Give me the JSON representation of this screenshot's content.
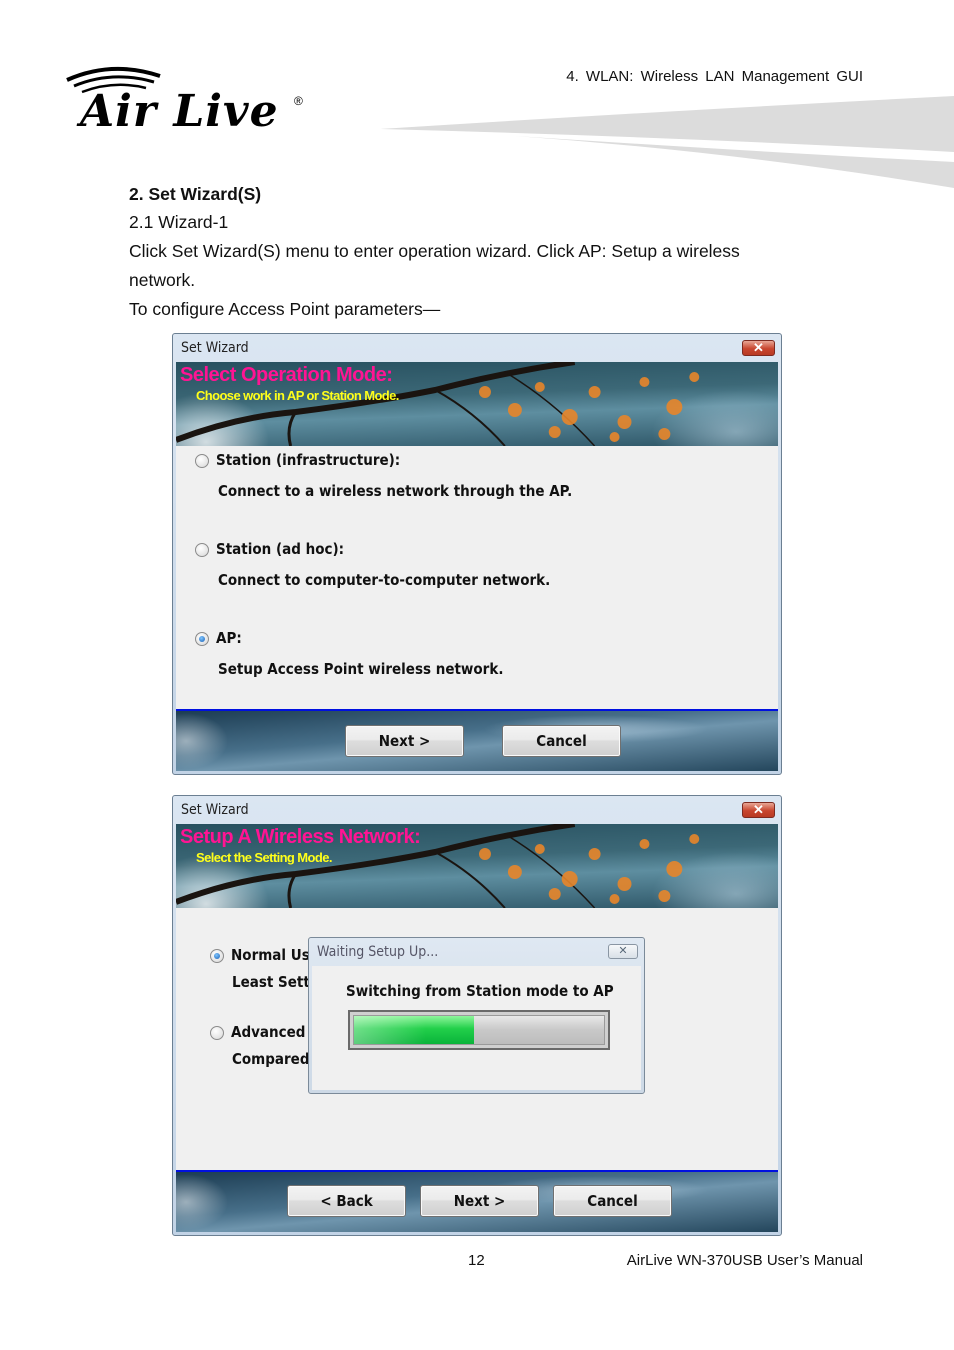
{
  "header": {
    "logo_text": "Air Live",
    "logo_registered": "®",
    "chapter_title": "4. WLAN: Wireless LAN Management GUI"
  },
  "content": {
    "section_title": "2. Set Wizard(S)",
    "subsection": "2.1 Wizard-1",
    "body_line1": "Click Set Wizard(S) menu to enter operation wizard. Click AP: Setup a wireless",
    "body_line2": "network.",
    "body_line3": "To configure Access Point parameters—"
  },
  "wizard1": {
    "window_title": "Set Wizard",
    "close_icon": "close-icon",
    "banner_title": "Select Operation Mode:",
    "banner_subtitle": "Choose work in AP or Station Mode.",
    "options": [
      {
        "label": "Station (infrastructure):",
        "description": "Connect to a wireless network through the AP.",
        "selected": false
      },
      {
        "label": "Station (ad hoc):",
        "description": "Connect to computer-to-computer network.",
        "selected": false
      },
      {
        "label": "AP:",
        "description": "Setup Access Point wireless network.",
        "selected": true
      }
    ],
    "buttons": {
      "next": "Next >",
      "cancel": "Cancel"
    }
  },
  "wizard2": {
    "window_title": "Set Wizard",
    "banner_title": "Setup A Wireless Network:",
    "banner_subtitle": "Select the Setting Mode.",
    "options": [
      {
        "label": "Normal Us",
        "description": "Least Sett",
        "selected": true
      },
      {
        "label": "Advanced",
        "description": "Compared",
        "selected": false
      }
    ],
    "buttons": {
      "back": "< Back",
      "next": "Next >",
      "cancel": "Cancel"
    },
    "popup": {
      "title": "Waiting Setup Up...",
      "message": "Switching from Station mode to AP",
      "progress_percent": 48
    }
  },
  "footer": {
    "page_number": "12",
    "manual_title": "AirLive WN-370USB User’s Manual"
  }
}
